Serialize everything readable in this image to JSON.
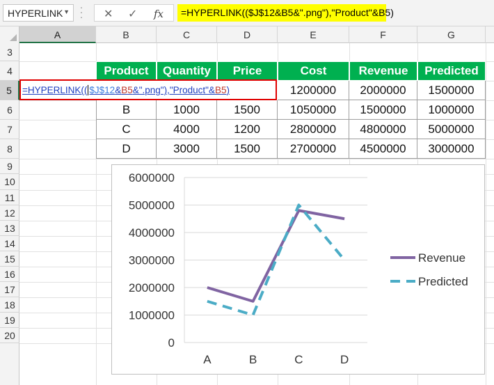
{
  "formula_bar": {
    "name_box": "HYPERLINK",
    "formula": "=HYPERLINK(($J$12&B5&\".png\"),\"Product\"&B5)"
  },
  "sheet": {
    "columns": [
      "A",
      "B",
      "C",
      "D",
      "E",
      "F",
      "G"
    ],
    "rows": [
      "3",
      "4",
      "5",
      "6",
      "7",
      "8",
      "9",
      "10",
      "11",
      "12",
      "13",
      "14",
      "15",
      "16",
      "17",
      "18",
      "19",
      "20"
    ]
  },
  "table": {
    "headers": [
      "Product",
      "Quantity",
      "Price",
      "Cost",
      "Revenue",
      "Predicted"
    ],
    "row5_tail": [
      "1200000",
      "2000000",
      "1500000"
    ],
    "rows": [
      [
        "B",
        "1000",
        "1500",
        "1050000",
        "1500000",
        "1000000"
      ],
      [
        "C",
        "4000",
        "1200",
        "2800000",
        "4800000",
        "5000000"
      ],
      [
        "D",
        "3000",
        "1500",
        "2700000",
        "4500000",
        "3000000"
      ]
    ]
  },
  "editing": {
    "parts": [
      "=HYPERLINK((",
      "$J$12",
      "&",
      "B5",
      "&\".png\"),\"Product\"&",
      "B5",
      ")"
    ]
  },
  "chart_data": {
    "type": "line",
    "categories": [
      "A",
      "B",
      "C",
      "D"
    ],
    "series": [
      {
        "name": "Revenue",
        "values": [
          2000000,
          1500000,
          4800000,
          4500000
        ],
        "color": "#8064a2",
        "dash": "solid"
      },
      {
        "name": "Predicted",
        "values": [
          1500000,
          1000000,
          5000000,
          3000000
        ],
        "color": "#4bacc6",
        "dash": "dashed"
      }
    ],
    "ylim": [
      0,
      6000000
    ],
    "yticks": [
      "0",
      "1000000",
      "2000000",
      "3000000",
      "4000000",
      "5000000",
      "6000000"
    ],
    "grid": true,
    "legend": "right"
  }
}
